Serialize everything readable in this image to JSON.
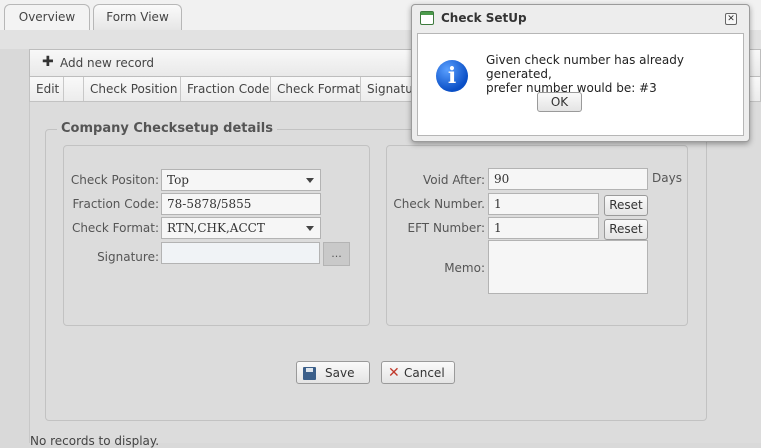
{
  "tabs": [
    {
      "label": "Overview",
      "active": true
    },
    {
      "label": "Form View",
      "active": false
    }
  ],
  "toolbar": {
    "add_label": "Add new record"
  },
  "grid": {
    "columns": [
      "Edit",
      "",
      "Check Position",
      "Fraction Code",
      "Check Format",
      "Signature"
    ],
    "empty_text": "No records to display."
  },
  "form": {
    "legend": "Company Checksetup details",
    "left": {
      "check_position_label": "Check Positon:",
      "check_position_value": "Top",
      "fraction_code_label": "Fraction Code:",
      "fraction_code_value": "78-5878/5855",
      "check_format_label": "Check Format:",
      "check_format_value": "RTN,CHK,ACCT",
      "signature_label": "Signature:",
      "signature_value": "",
      "browse_label": "..."
    },
    "right": {
      "void_after_label": "Void After:",
      "void_after_value": "90",
      "days_label": "Days",
      "check_number_label": "Check Number.",
      "check_number_value": "1",
      "eft_number_label": "EFT Number:",
      "eft_number_value": "1",
      "reset_label": "Reset",
      "memo_label": "Memo:",
      "memo_value": ""
    },
    "save_label": "Save",
    "cancel_label": "Cancel"
  },
  "dialog": {
    "title": "Check SetUp",
    "close_glyph": "✕",
    "icon_glyph": "i",
    "message_line1": "Given check number has already generated,",
    "message_line2": "prefer number would be: #3",
    "ok_label": "OK"
  },
  "colors": {
    "info_blue": "#0a4fc6",
    "cancel_red": "#c0392b",
    "save_blue": "#3b5f8a"
  }
}
